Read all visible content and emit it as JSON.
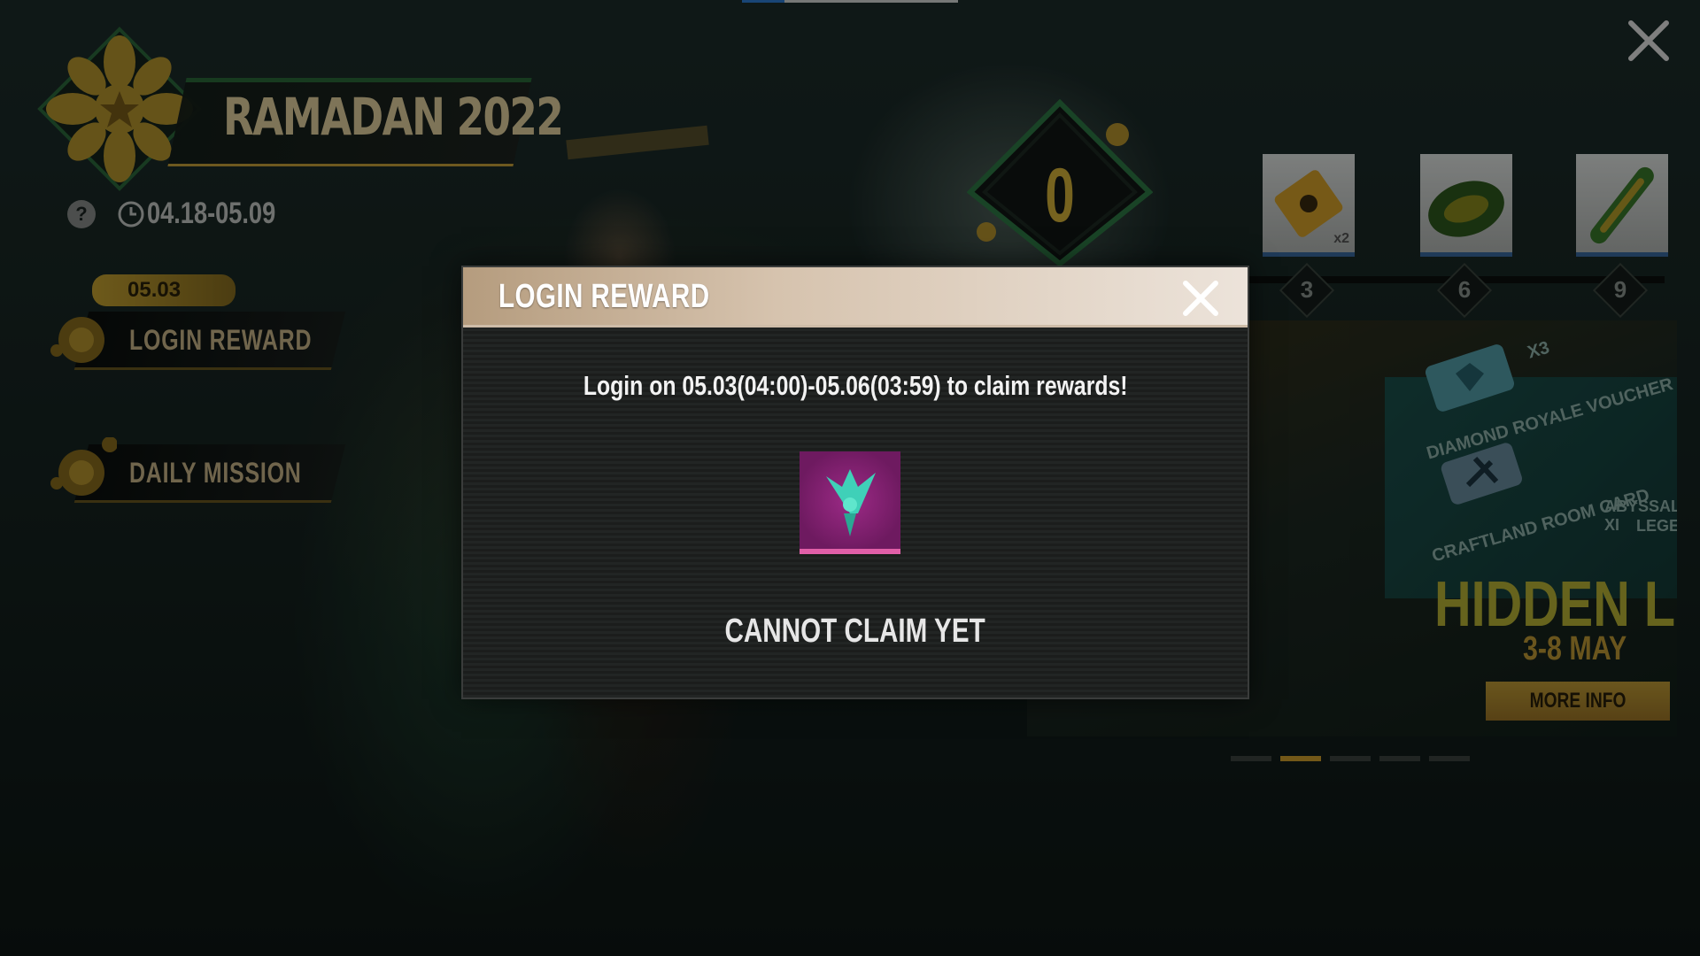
{
  "event": {
    "title": "RAMADAN 2022",
    "help_symbol": "?",
    "date_range": "04.18-05.09"
  },
  "sidebar": {
    "date_tag": "05.03",
    "items": [
      {
        "label": "LOGIN REWARD"
      },
      {
        "label": "DAILY MISSION"
      }
    ]
  },
  "progress": {
    "current_level": "0",
    "milestones": [
      {
        "step": "3",
        "reward_icon": "ticket-icon",
        "quantity": "x2"
      },
      {
        "step": "6",
        "reward_icon": "parachute-icon"
      },
      {
        "step": "9",
        "reward_icon": "surfboard-icon"
      }
    ]
  },
  "banner": {
    "item1": "DIAMOND ROYALE VOUCHER",
    "item1_qty": "X3",
    "item2": "CRAFTLAND ROOM CARD",
    "item3_line1": "ABYSSAL XI",
    "item3_line2": "LEGEN",
    "headline": "HIDDEN LOE",
    "dates": "3-8 MAY",
    "button": "MORE INFO",
    "pages": 5,
    "active_page": 2
  },
  "modal": {
    "title": "LOGIN REWARD",
    "message": "Login on 05.03(04:00)-05.06(03:59) to claim rewards!",
    "reward_icon": "eagle-icon",
    "status": "CANNOT CLAIM YET"
  },
  "colors": {
    "accent_gold": "#c9a33a",
    "reward_bg": "#8a2278",
    "reward_border": "#e05fa8"
  }
}
